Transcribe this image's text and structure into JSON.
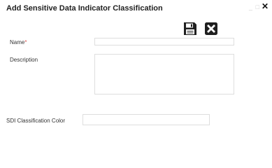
{
  "dialog": {
    "title": "Add Sensitive Data Indicator Classification",
    "window_controls": {
      "minimize": "_",
      "maximize": "□",
      "close": "✕"
    }
  },
  "toolbar": {
    "save_icon": "save-icon",
    "cancel_icon": "close-box-icon"
  },
  "form": {
    "name": {
      "label": "Name",
      "required_marker": "*",
      "value": "",
      "placeholder": ""
    },
    "description": {
      "label": "Description",
      "value": "",
      "placeholder": ""
    },
    "sdi_color": {
      "label": "SDI Classification Color",
      "value": "",
      "placeholder": ""
    }
  },
  "colors": {
    "required_asterisk": "#d9534f",
    "field_border": "#dedede",
    "icon": "#1f1f1f"
  }
}
